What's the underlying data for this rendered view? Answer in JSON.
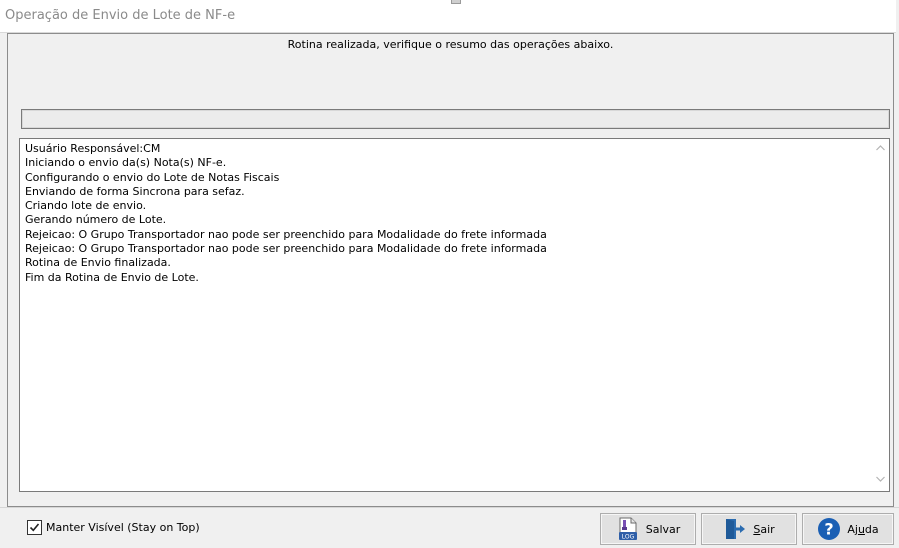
{
  "window": {
    "title": "Operação de Envio de Lote de NF-e"
  },
  "header": {
    "message": "Rotina realizada, verifique o resumo das operações abaixo."
  },
  "log": {
    "lines": [
      "Usuário Responsável:CM",
      "Iniciando o envio da(s) Nota(s) NF-e.",
      "Configurando o envio do Lote de Notas Fiscais",
      "Enviando de forma Sincrona para sefaz.",
      "Criando lote de envio.",
      "Gerando número de Lote.",
      "Rejeicao: O Grupo Transportador nao pode ser preenchido para Modalidade do frete informada",
      "Rejeicao: O Grupo Transportador nao pode ser preenchido para Modalidade do frete informada",
      "Rotina de Envio finalizada.",
      "Fim da Rotina de Envio de Lote."
    ]
  },
  "footer": {
    "stay_on_top": {
      "label": "Manter Visível (Stay on Top)",
      "checked": true
    },
    "buttons": {
      "salvar": "Salvar",
      "sair_prefix": "",
      "sair_underline": "S",
      "sair_suffix": "air",
      "ajuda_prefix": "Aj",
      "ajuda_underline": "u",
      "ajuda_suffix": "da"
    }
  },
  "icons": {
    "salvar": "log-file-icon",
    "sair": "exit-door-icon",
    "ajuda": "help-icon"
  },
  "colors": {
    "help_blue": "#1a5fb4",
    "exit_blue": "#2b6cb0"
  }
}
